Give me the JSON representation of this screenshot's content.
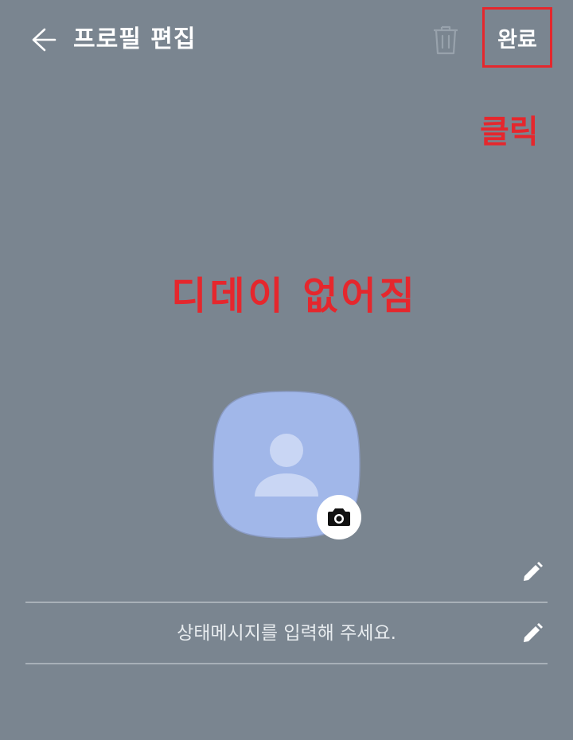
{
  "header": {
    "title": "프로필 편집",
    "done_label": "완료"
  },
  "annotations": {
    "click_label": "클릭",
    "dday_label": "디데이 없어짐"
  },
  "profile": {
    "status_placeholder": "상태메시지를 입력해 주세요."
  },
  "colors": {
    "background": "#7a8590",
    "avatar_fill": "#a1b7e9",
    "annotation_red": "#e5272d"
  },
  "icons": {
    "back": "back-arrow-icon",
    "trash": "trash-icon",
    "camera": "camera-icon",
    "edit": "pencil-icon",
    "avatar": "person-icon"
  }
}
